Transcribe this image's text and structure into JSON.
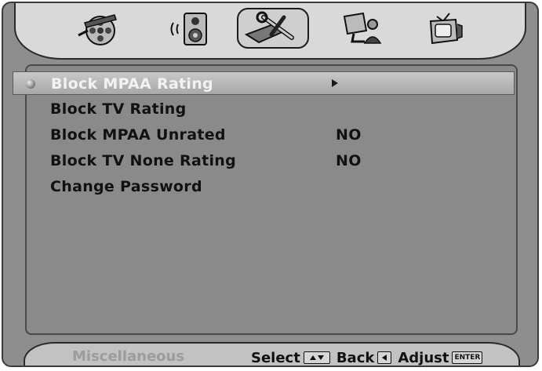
{
  "icon_bar": {
    "tabs": [
      {
        "name": "movie-reel-icon",
        "active": false
      },
      {
        "name": "speaker-icon",
        "active": false
      },
      {
        "name": "tools-icon",
        "active": true
      },
      {
        "name": "computer-person-icon",
        "active": false
      },
      {
        "name": "tv-icon",
        "active": false
      }
    ]
  },
  "menu": {
    "items": [
      {
        "label": "Block MPAA Rating",
        "value": "",
        "selected": true,
        "has_submenu": true
      },
      {
        "label": "Block TV Rating",
        "value": "",
        "selected": false,
        "has_submenu": false
      },
      {
        "label": "Block MPAA Unrated",
        "value": "NO",
        "selected": false,
        "has_submenu": false
      },
      {
        "label": "Block TV None Rating",
        "value": "NO",
        "selected": false,
        "has_submenu": false
      },
      {
        "label": "Change Password",
        "value": "",
        "selected": false,
        "has_submenu": false
      }
    ]
  },
  "footer": {
    "section_name": "Miscellaneous",
    "select_label": "Select",
    "back_label": "Back",
    "adjust_label": "Adjust",
    "enter_key_label": "ENTER"
  }
}
